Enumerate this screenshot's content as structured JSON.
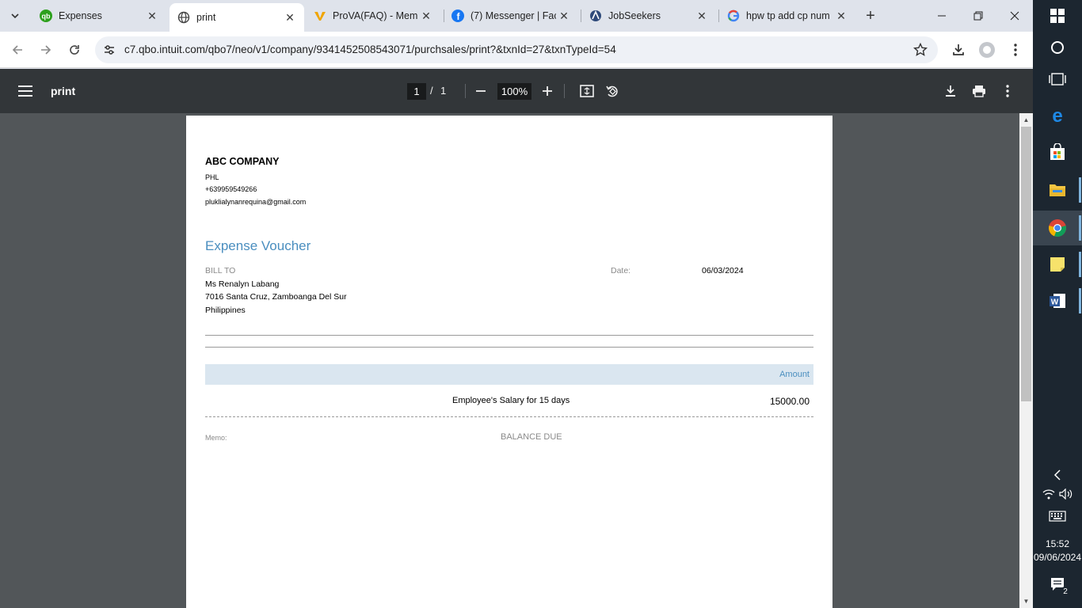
{
  "tabs": [
    {
      "title": "Expenses",
      "icon": "quickbooks-icon",
      "active": false
    },
    {
      "title": "print",
      "icon": "globe-icon",
      "active": true
    },
    {
      "title": "ProVA(FAQ) - Memb",
      "icon": "prova-icon",
      "active": false
    },
    {
      "title": "(7) Messenger | Fac",
      "icon": "facebook-icon",
      "active": false
    },
    {
      "title": "JobSeekers",
      "icon": "jobseekers-icon",
      "active": false
    },
    {
      "title": "hpw tp add cp num",
      "icon": "google-icon",
      "active": false
    }
  ],
  "address_bar": {
    "url": "c7.qbo.intuit.com/qbo7/neo/v1/company/9341452508543071/purchsales/print?&txnId=27&txnTypeId=54"
  },
  "pdf_viewer": {
    "title": "print",
    "current_page": "1",
    "page_separator": "/",
    "total_pages": "1",
    "zoom": "100%"
  },
  "document": {
    "company_name": "ABC COMPANY",
    "company_country": "PHL",
    "company_phone": "+639959549266",
    "company_email": "pluklialynanrequina@gmail.com",
    "title": "Expense Voucher",
    "bill_to_label": "BILL TO",
    "bill_to_name": "Ms Renalyn Labang",
    "bill_to_address": "7016 Santa Cruz, Zamboanga Del Sur",
    "bill_to_country": "Philippines",
    "date_label": "Date:",
    "date_value": "06/03/2024",
    "amount_header": "Amount",
    "line_description": "Employee's Salary for 15 days",
    "line_amount": "15000.00",
    "memo_label": "Memo:",
    "balance_due_label": "BALANCE DUE"
  },
  "taskbar": {
    "time": "15:52",
    "date": "09/06/2024",
    "notification_count": "2"
  },
  "colors": {
    "accent_blue": "#4a8ebf",
    "pdf_toolbar": "#323639",
    "pdf_background": "#525659",
    "taskbar": "#1c2630"
  }
}
